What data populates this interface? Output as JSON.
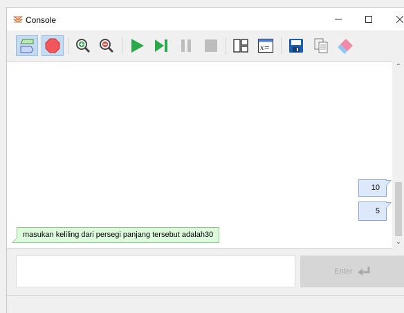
{
  "window": {
    "title": "Console"
  },
  "toolbar": {
    "buttons": [
      {
        "icon": "flowchart-mode-icon",
        "active": true
      },
      {
        "icon": "stop-sign-icon",
        "active": true
      },
      {
        "icon": "zoom-in-icon"
      },
      {
        "icon": "zoom-out-icon"
      },
      {
        "icon": "run-icon"
      },
      {
        "icon": "step-icon"
      },
      {
        "icon": "pause-icon"
      },
      {
        "icon": "stop-icon"
      },
      {
        "icon": "layout-icon"
      },
      {
        "icon": "variables-icon"
      },
      {
        "icon": "save-icon"
      },
      {
        "icon": "copy-icon"
      },
      {
        "icon": "eraser-icon"
      }
    ]
  },
  "console": {
    "outputs": [
      "10",
      "5"
    ],
    "inputs": [
      "masukan keliling dari persegi panjang tersebut adalah30"
    ]
  },
  "input": {
    "value": "",
    "placeholder": ""
  },
  "enter_button": {
    "label": "Enter"
  },
  "colors": {
    "accent": "#c4dbf1",
    "output_bubble": "#dde9fb",
    "input_bubble": "#ddfadd",
    "run_green": "#2ba84a",
    "stop_red": "#f0575a"
  }
}
